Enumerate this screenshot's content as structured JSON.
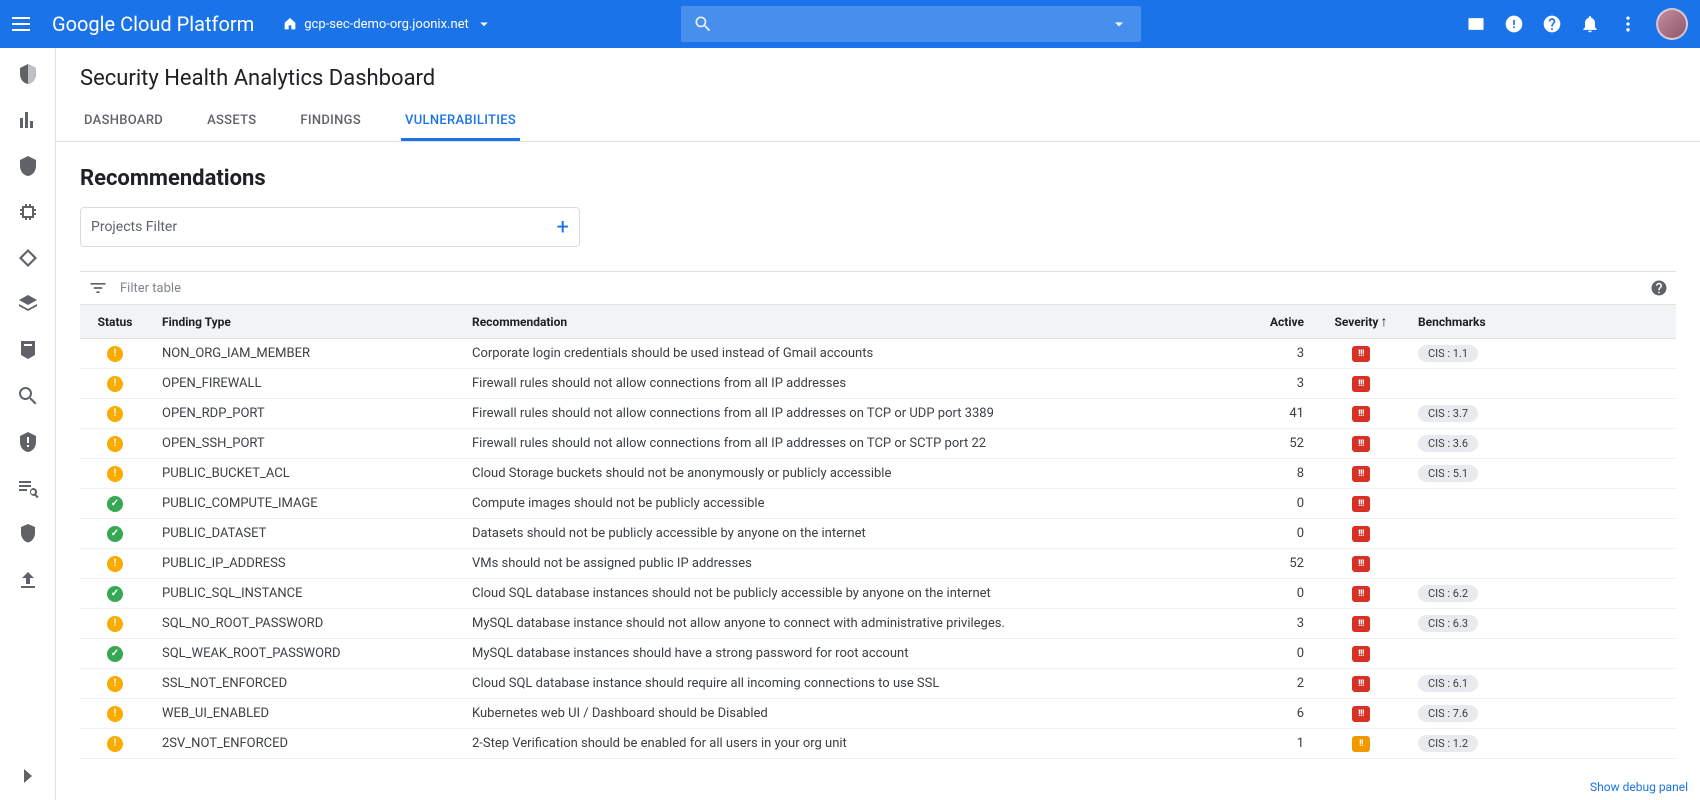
{
  "header": {
    "logo": "Google Cloud Platform",
    "project": "gcp-sec-demo-org.joonix.net"
  },
  "page": {
    "title": "Security Health Analytics Dashboard",
    "tabs": [
      "DASHBOARD",
      "ASSETS",
      "FINDINGS",
      "VULNERABILITIES"
    ],
    "active_tab_index": 3
  },
  "section": {
    "heading": "Recommendations",
    "projects_filter_placeholder": "Projects Filter",
    "table_filter_placeholder": "Filter table"
  },
  "columns": {
    "status": "Status",
    "finding": "Finding Type",
    "recommendation": "Recommendation",
    "active": "Active",
    "severity": "Severity",
    "benchmarks": "Benchmarks"
  },
  "rows": [
    {
      "status": "warn",
      "finding": "NON_ORG_IAM_MEMBER",
      "recommendation": "Corporate login credentials should be used instead of Gmail accounts",
      "active": 3,
      "severity": "critical",
      "benchmark": "CIS : 1.1"
    },
    {
      "status": "warn",
      "finding": "OPEN_FIREWALL",
      "recommendation": "Firewall rules should not allow connections from all IP addresses",
      "active": 3,
      "severity": "critical",
      "benchmark": ""
    },
    {
      "status": "warn",
      "finding": "OPEN_RDP_PORT",
      "recommendation": "Firewall rules should not allow connections from all IP addresses on TCP or UDP port 3389",
      "active": 41,
      "severity": "critical",
      "benchmark": "CIS : 3.7"
    },
    {
      "status": "warn",
      "finding": "OPEN_SSH_PORT",
      "recommendation": "Firewall rules should not allow connections from all IP addresses on TCP or SCTP port 22",
      "active": 52,
      "severity": "critical",
      "benchmark": "CIS : 3.6"
    },
    {
      "status": "warn",
      "finding": "PUBLIC_BUCKET_ACL",
      "recommendation": "Cloud Storage buckets should not be anonymously or publicly accessible",
      "active": 8,
      "severity": "critical",
      "benchmark": "CIS : 5.1"
    },
    {
      "status": "ok",
      "finding": "PUBLIC_COMPUTE_IMAGE",
      "recommendation": "Compute images should not be publicly accessible",
      "active": 0,
      "severity": "critical",
      "benchmark": ""
    },
    {
      "status": "ok",
      "finding": "PUBLIC_DATASET",
      "recommendation": "Datasets should not be publicly accessible by anyone on the internet",
      "active": 0,
      "severity": "critical",
      "benchmark": ""
    },
    {
      "status": "warn",
      "finding": "PUBLIC_IP_ADDRESS",
      "recommendation": "VMs should not be assigned public IP addresses",
      "active": 52,
      "severity": "critical",
      "benchmark": ""
    },
    {
      "status": "ok",
      "finding": "PUBLIC_SQL_INSTANCE",
      "recommendation": "Cloud SQL database instances should not be publicly accessible by anyone on the internet",
      "active": 0,
      "severity": "critical",
      "benchmark": "CIS : 6.2"
    },
    {
      "status": "warn",
      "finding": "SQL_NO_ROOT_PASSWORD",
      "recommendation": "MySQL database instance should not allow anyone to connect with administrative privileges.",
      "active": 3,
      "severity": "critical",
      "benchmark": "CIS : 6.3"
    },
    {
      "status": "ok",
      "finding": "SQL_WEAK_ROOT_PASSWORD",
      "recommendation": "MySQL database instances should have a strong password for root account",
      "active": 0,
      "severity": "critical",
      "benchmark": ""
    },
    {
      "status": "warn",
      "finding": "SSL_NOT_ENFORCED",
      "recommendation": "Cloud SQL database instance should require all incoming connections to use SSL",
      "active": 2,
      "severity": "critical",
      "benchmark": "CIS : 6.1"
    },
    {
      "status": "warn",
      "finding": "WEB_UI_ENABLED",
      "recommendation": "Kubernetes web UI / Dashboard should be Disabled",
      "active": 6,
      "severity": "critical",
      "benchmark": "CIS : 7.6"
    },
    {
      "status": "warn",
      "finding": "2SV_NOT_ENFORCED",
      "recommendation": "2-Step Verification should be enabled for all users in your org unit",
      "active": 1,
      "severity": "high",
      "benchmark": "CIS : 1.2"
    }
  ],
  "footer": {
    "debug_link": "Show debug panel"
  }
}
